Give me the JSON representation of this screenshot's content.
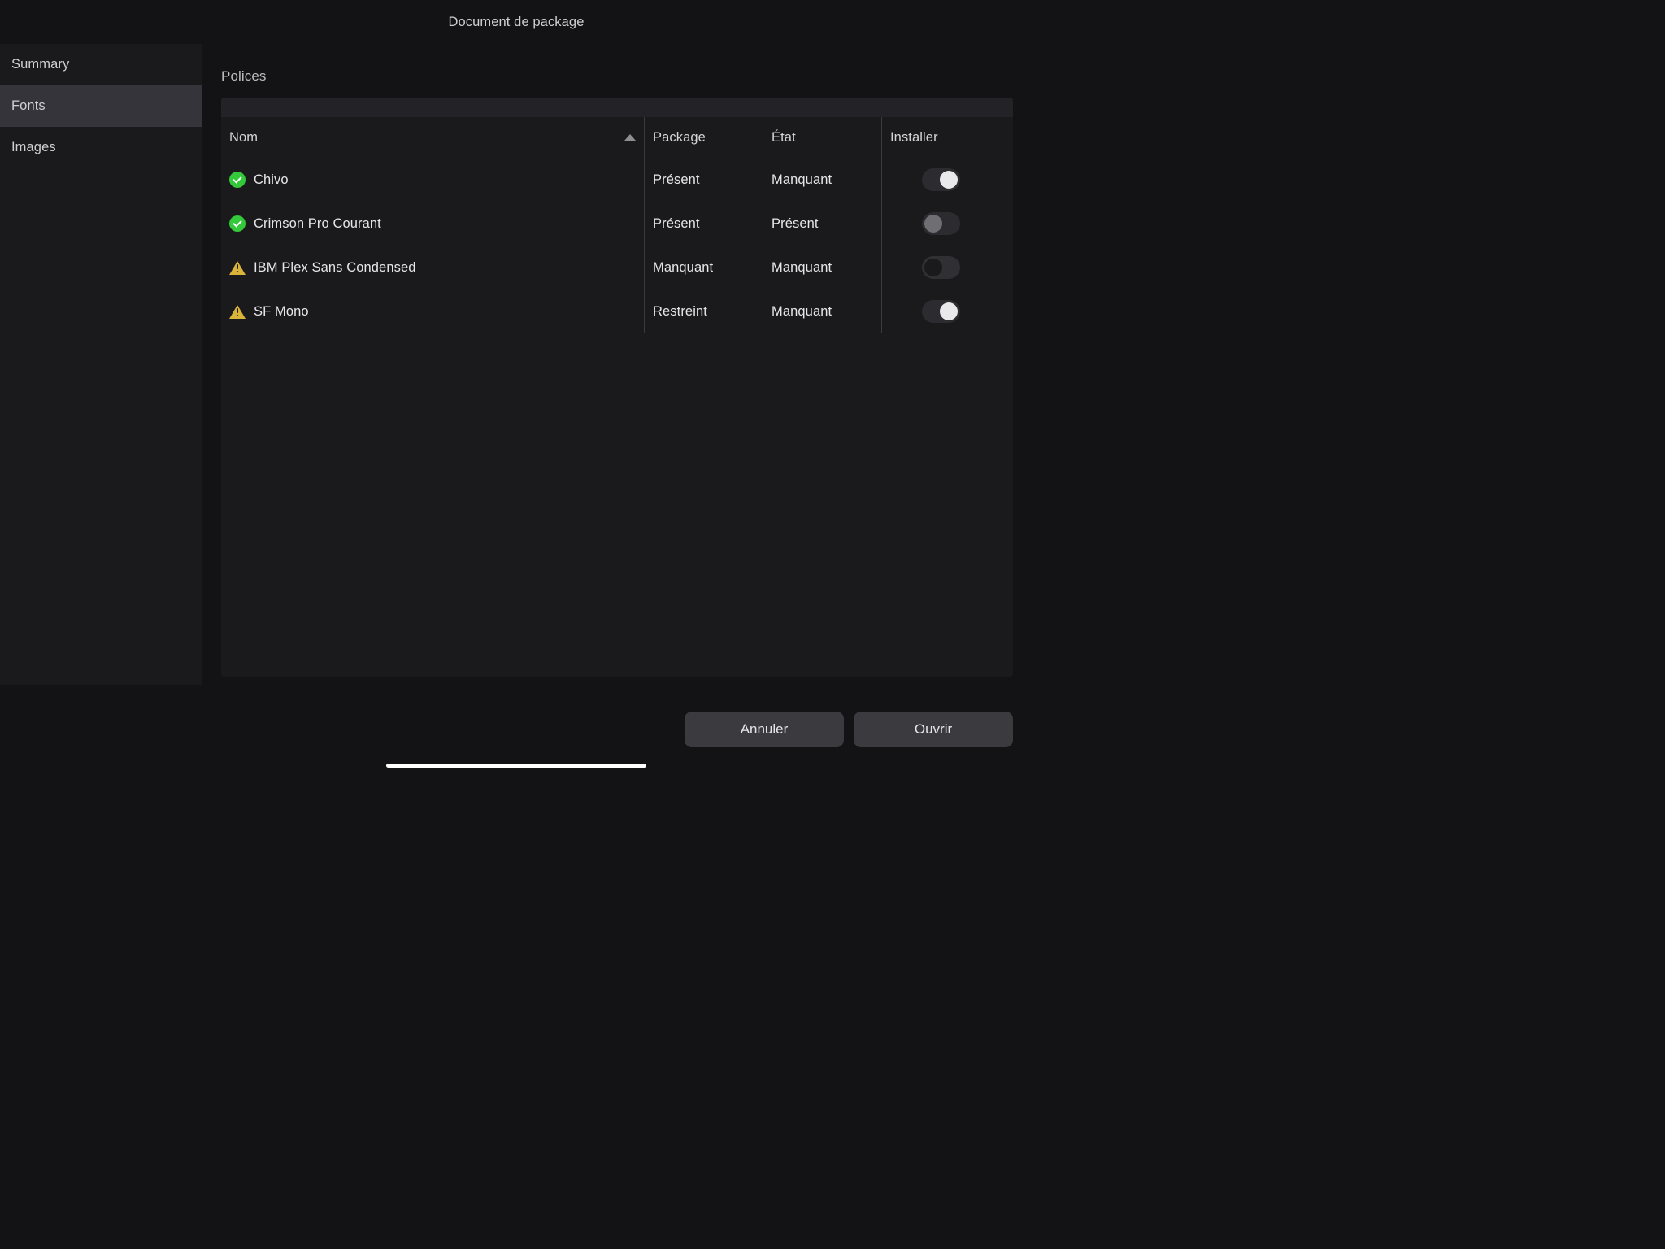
{
  "window": {
    "title": "Document de package"
  },
  "sidebar": {
    "items": [
      {
        "id": "summary",
        "label": "Summary",
        "active": false
      },
      {
        "id": "fonts",
        "label": "Fonts",
        "active": true
      },
      {
        "id": "images",
        "label": "Images",
        "active": false
      }
    ]
  },
  "section": {
    "title": "Polices"
  },
  "table": {
    "columns": [
      "Nom",
      "Package",
      "État",
      "Installer"
    ],
    "sort": {
      "columnIndex": 0,
      "direction": "asc"
    },
    "rows": [
      {
        "status": "ok",
        "name": "Chivo",
        "package": "Présent",
        "etat": "Manquant",
        "install": {
          "on": true,
          "knob": "light"
        }
      },
      {
        "status": "ok",
        "name": "Crimson Pro Courant",
        "package": "Présent",
        "etat": "Présent",
        "install": {
          "on": false,
          "knob": "dim"
        }
      },
      {
        "status": "warn",
        "name": "IBM Plex Sans Condensed",
        "package": "Manquant",
        "etat": "Manquant",
        "install": {
          "on": false,
          "knob": "dark"
        }
      },
      {
        "status": "warn",
        "name": "SF Mono",
        "package": "Restreint",
        "etat": "Manquant",
        "install": {
          "on": true,
          "knob": "light"
        }
      }
    ]
  },
  "footer": {
    "cancel": "Annuler",
    "open": "Ouvrir"
  }
}
